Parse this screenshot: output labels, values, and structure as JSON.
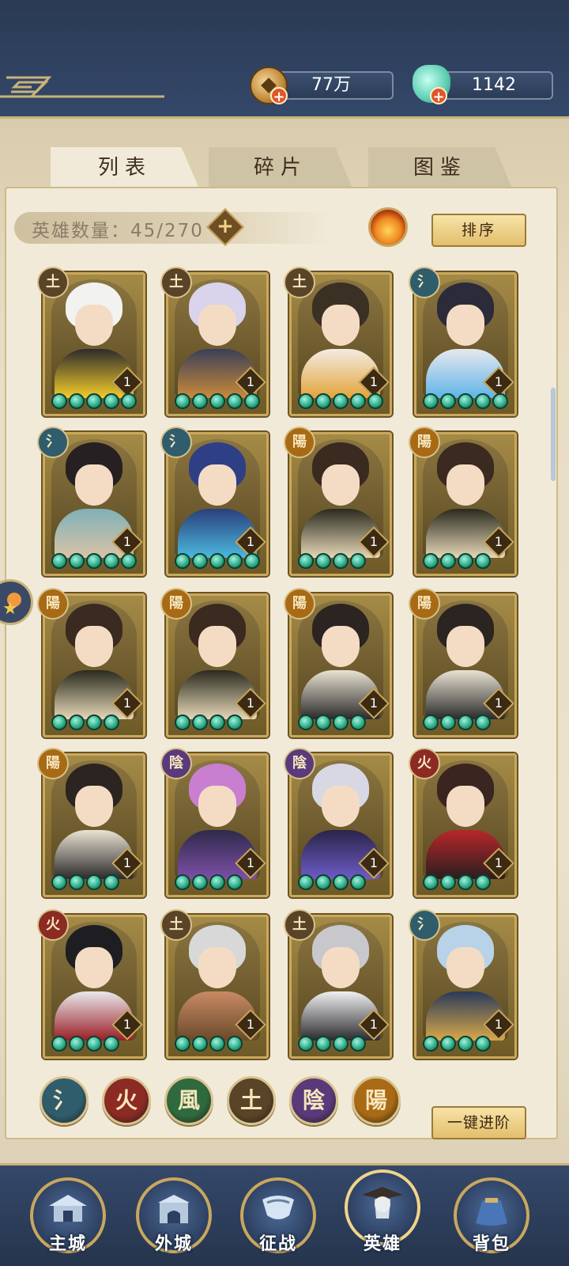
{
  "resources": {
    "coin": "77万",
    "jade": "1142"
  },
  "tabs": [
    "列表",
    "碎片",
    "图鉴"
  ],
  "hero_count_label": "英雄数量：45/270",
  "sort_label": "排序",
  "advance_label": "一键进阶",
  "elements": {
    "water": {
      "glyph": "氵",
      "color": "#2f5d6c"
    },
    "fire": {
      "glyph": "火",
      "color": "#8c2a24"
    },
    "wind": {
      "glyph": "風",
      "color": "#2f6a3e"
    },
    "earth": {
      "glyph": "土",
      "color": "#5a4428"
    },
    "yin": {
      "glyph": "陰",
      "color": "#5a3a7a"
    },
    "yang": {
      "glyph": "陽",
      "color": "#a86a14"
    }
  },
  "heroes": [
    {
      "element": "earth",
      "glyph": "土",
      "level": "1",
      "stars": 5,
      "hair": "#f2f2f0",
      "body": "#2c2c2c",
      "accent": "#f5cc2a"
    },
    {
      "element": "earth",
      "glyph": "土",
      "level": "1",
      "stars": 5,
      "hair": "#d9d3ec",
      "body": "#3a3f58",
      "accent": "#c98a3a"
    },
    {
      "element": "earth",
      "glyph": "土",
      "level": "1",
      "stars": 5,
      "hair": "#3a3024",
      "body": "#f2ece2",
      "accent": "#e3a43a"
    },
    {
      "element": "water",
      "glyph": "氵",
      "level": "1",
      "stars": 5,
      "hair": "#2b2b3a",
      "body": "#e6e8ee",
      "accent": "#5fb4e8"
    },
    {
      "element": "water",
      "glyph": "氵",
      "level": "1",
      "stars": 5,
      "hair": "#262022",
      "body": "#7fb0b8",
      "accent": "#d8c4a6"
    },
    {
      "element": "water",
      "glyph": "氵",
      "level": "1",
      "stars": 5,
      "hair": "#2e3f86",
      "body": "#2a3f7a",
      "accent": "#4cb8e0"
    },
    {
      "element": "yang",
      "glyph": "陽",
      "level": "1",
      "stars": 4,
      "hair": "#3a2a20",
      "body": "#2a2a1e",
      "accent": "#e6d8b8"
    },
    {
      "element": "yang",
      "glyph": "陽",
      "level": "1",
      "stars": 4,
      "hair": "#3a2a20",
      "body": "#2a2a1e",
      "accent": "#e6d8b8"
    },
    {
      "element": "yang",
      "glyph": "陽",
      "level": "1",
      "stars": 4,
      "hair": "#3a2a20",
      "body": "#2a2a1e",
      "accent": "#e6d8b8"
    },
    {
      "element": "yang",
      "glyph": "陽",
      "level": "1",
      "stars": 4,
      "hair": "#3a2a20",
      "body": "#2a2a1e",
      "accent": "#e6d8b8"
    },
    {
      "element": "yang",
      "glyph": "陽",
      "level": "1",
      "stars": 4,
      "hair": "#2c2420",
      "body": "#e8e2d2",
      "accent": "#2a2a2a"
    },
    {
      "element": "yang",
      "glyph": "陽",
      "level": "1",
      "stars": 4,
      "hair": "#2c2420",
      "body": "#e8e2d2",
      "accent": "#2a2a2a"
    },
    {
      "element": "yang",
      "glyph": "陽",
      "level": "1",
      "stars": 4,
      "hair": "#2c2420",
      "body": "#e8e2d2",
      "accent": "#2a2a2a"
    },
    {
      "element": "yin",
      "glyph": "陰",
      "level": "1",
      "stars": 4,
      "hair": "#c87fd0",
      "body": "#2e2a4a",
      "accent": "#7e4fa8"
    },
    {
      "element": "yin",
      "glyph": "陰",
      "level": "1",
      "stars": 4,
      "hair": "#d8d8e4",
      "body": "#2a2448",
      "accent": "#6c5cc8"
    },
    {
      "element": "fire",
      "glyph": "火",
      "level": "1",
      "stars": 4,
      "hair": "#3a2520",
      "body": "#b8262a",
      "accent": "#2a1e1e"
    },
    {
      "element": "fire",
      "glyph": "火",
      "level": "1",
      "stars": 4,
      "hair": "#1e1e22",
      "body": "#e8e8ec",
      "accent": "#9a1e24"
    },
    {
      "element": "earth",
      "glyph": "土",
      "level": "1",
      "stars": 4,
      "hair": "#d8d8d8",
      "body": "#c98a64",
      "accent": "#6a4a2a"
    },
    {
      "element": "earth",
      "glyph": "土",
      "level": "1",
      "stars": 4,
      "hair": "#c8c8cc",
      "body": "#f0f0f2",
      "accent": "#2a2a2e"
    },
    {
      "element": "water",
      "glyph": "氵",
      "level": "1",
      "stars": 4,
      "hair": "#b8d2e8",
      "body": "#2a3a5a",
      "accent": "#d8a84a"
    }
  ],
  "filters": [
    "water",
    "fire",
    "wind",
    "earth",
    "yin",
    "yang"
  ],
  "nav": [
    {
      "id": "main-city",
      "label": "主城",
      "icon": "palace-icon"
    },
    {
      "id": "outer-city",
      "label": "外城",
      "icon": "gate-icon"
    },
    {
      "id": "campaign",
      "label": "征战",
      "icon": "war-horn-icon"
    },
    {
      "id": "heroes",
      "label": "英雄",
      "icon": "hero-portrait-icon"
    },
    {
      "id": "bag",
      "label": "背包",
      "icon": "bag-icon"
    }
  ]
}
